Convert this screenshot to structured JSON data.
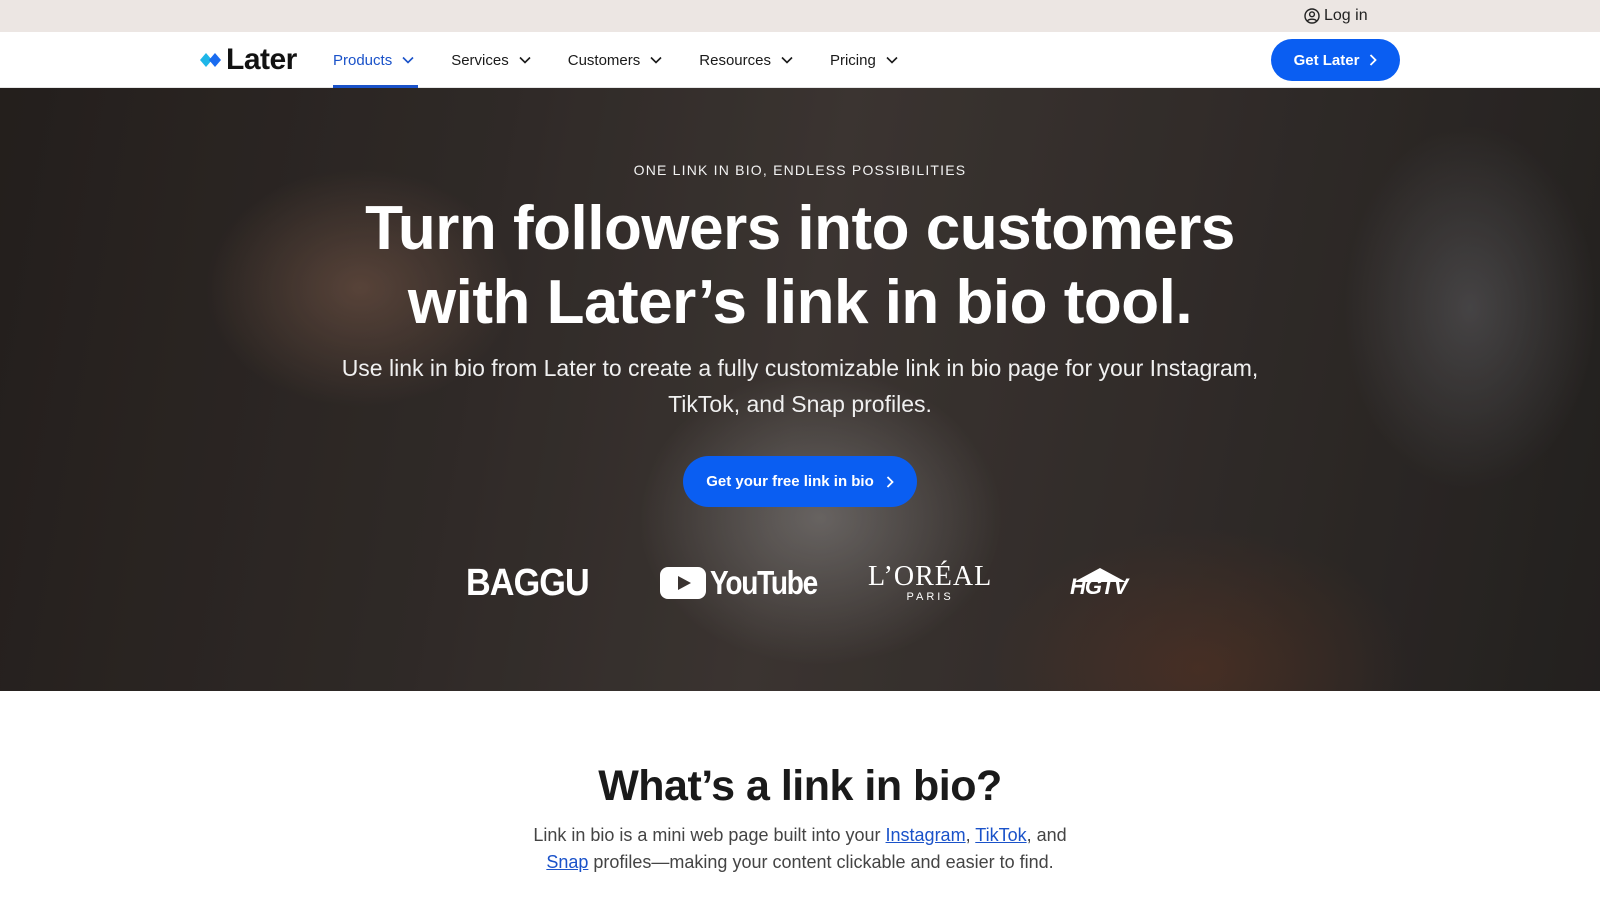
{
  "utility_bar": {
    "login_label": "Log in",
    "login_icon": "user-circle-icon"
  },
  "nav": {
    "logo_text": "Later",
    "items": [
      {
        "label": "Products",
        "active": true
      },
      {
        "label": "Services",
        "active": false
      },
      {
        "label": "Customers",
        "active": false
      },
      {
        "label": "Resources",
        "active": false
      },
      {
        "label": "Pricing",
        "active": false
      }
    ],
    "cta_label": "Get Later",
    "accent_color": "#0a5ef2",
    "active_color": "#1a52c9"
  },
  "hero": {
    "eyebrow": "ONE LINK IN BIO, ENDLESS POSSIBILITIES",
    "title": "Turn followers into customers with Later’s link in bio tool.",
    "subtitle": "Use link in bio from Later to create a fully customizable link in bio page for your Instagram, TikTok, and Snap profiles.",
    "cta_label": "Get your free link in bio",
    "brands": {
      "baggu": "BAGGU",
      "youtube": "YouTube",
      "loreal_main": "L’ORÉAL",
      "loreal_sub": "PARIS",
      "hgtv": "HGTV"
    }
  },
  "section": {
    "title": "What’s a link in bio?",
    "body_part1": "Link in bio is a mini web page built into your ",
    "link_instagram": "Instagram",
    "sep1": ", ",
    "link_tiktok": "TikTok",
    "sep2": ", and ",
    "link_snap": "Snap",
    "body_part2": " profiles—making your content clickable and easier to find."
  }
}
